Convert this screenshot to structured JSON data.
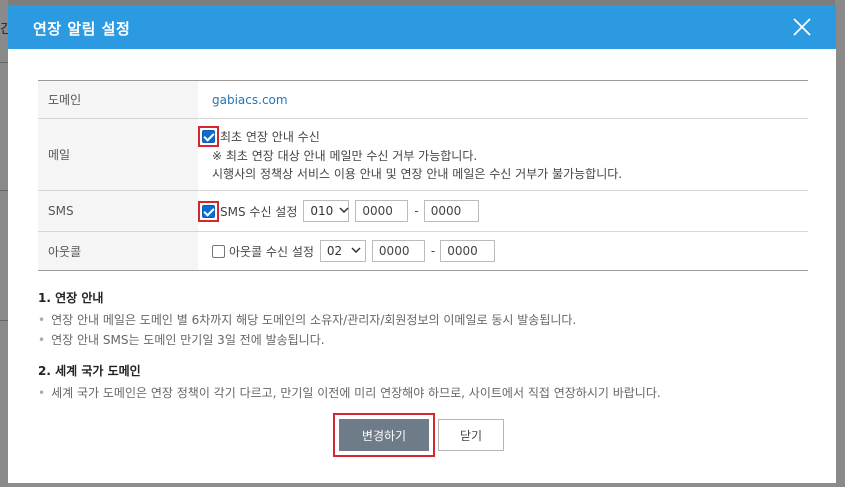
{
  "background": {
    "left_glyph": "긴"
  },
  "modal": {
    "title": "연장 알림 설정",
    "header_color": "#2c9ae0"
  },
  "table": {
    "domain": {
      "label": "도메인",
      "value": "gabiacs.com"
    },
    "mail": {
      "label": "메일",
      "checkbox_checked": true,
      "checkbox_label": "최초 연장 안내 수신",
      "note1": "※ 최초 연장 대상 안내 메일만 수신 거부 가능합니다.",
      "note2": "시행사의 정책상 서비스 이용 안내 및 연장 안내 메일은 수신 거부가 불가능합니다."
    },
    "sms": {
      "label": "SMS",
      "checkbox_checked": true,
      "checkbox_label": "SMS 수신 설정",
      "prefix": "010",
      "middle": "0000",
      "last": "0000",
      "separator": "-"
    },
    "outcall": {
      "label": "아웃콜",
      "checkbox_checked": false,
      "checkbox_label": "아웃콜 수신 설정",
      "prefix": "02",
      "middle": "0000",
      "last": "0000",
      "separator": "-"
    }
  },
  "guide1": {
    "title": "1. 연장 안내",
    "items": [
      "연장 안내 메일은 도메인 별 6차까지 해당 도메인의 소유자/관리자/회원정보의 이메일로 동시 발송됩니다.",
      "연장 안내 SMS는 도메인 만기일 3일 전에 발송됩니다."
    ]
  },
  "guide2": {
    "title": "2. 세계 국가 도메인",
    "items": [
      "세계 국가 도메인은 연장 정책이 각기 다르고, 만기일 이전에 미리 연장해야 하므로, 사이트에서 직접 연장하시기 바랍니다."
    ]
  },
  "buttons": {
    "submit": "변경하기",
    "close": "닫기"
  },
  "colors": {
    "highlight": "#d4272e",
    "link": "#2077b8",
    "primary_button": "#6e7b89",
    "checkbox": "#0a6ed1"
  }
}
